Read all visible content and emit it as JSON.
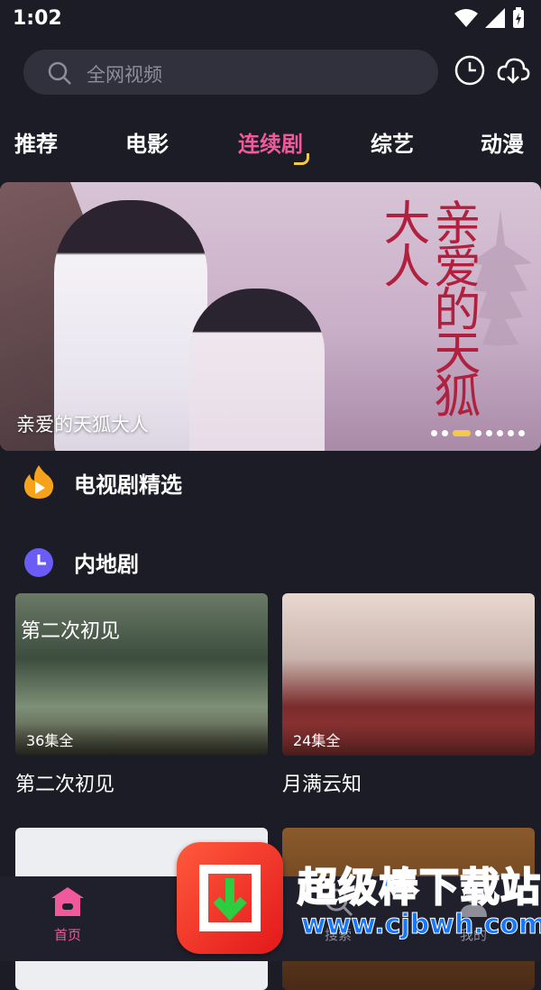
{
  "status_bar": {
    "time": "1:02"
  },
  "search": {
    "placeholder": "全网视频"
  },
  "tabs": [
    {
      "label": "推荐"
    },
    {
      "label": "电影"
    },
    {
      "label": "连续剧",
      "active": true
    },
    {
      "label": "综艺"
    },
    {
      "label": "动漫"
    }
  ],
  "banner": {
    "caption": "亲爱的天狐大人",
    "title_art": "亲爱的天狐大人",
    "carousel": {
      "total": 8,
      "active_index": 2
    }
  },
  "sections": {
    "featured": {
      "title": "电视剧精选"
    },
    "mainland": {
      "title": "内地剧"
    }
  },
  "cards": [
    {
      "title": "第二次初见",
      "episodes": "36集全",
      "poster_text": "第二次初见"
    },
    {
      "title": "月满云知",
      "episodes": "24集全"
    },
    {
      "title": "",
      "episodes": ""
    },
    {
      "title": "",
      "episodes": ""
    }
  ],
  "bottom_nav": [
    {
      "label": "首页",
      "icon": "home-icon",
      "active": true
    },
    {
      "label": "搜索",
      "icon": "search-icon"
    },
    {
      "label": "我的",
      "icon": "profile-icon"
    }
  ],
  "watermark": {
    "text": "超级棒下载站",
    "url": "www.cjbwh.com"
  },
  "colors": {
    "background": "#1b1c26",
    "accent_pink": "#f05a9c",
    "accent_yellow": "#f2c94c",
    "section_orange": "#f7a21b",
    "section_purple": "#6b5cf6"
  }
}
